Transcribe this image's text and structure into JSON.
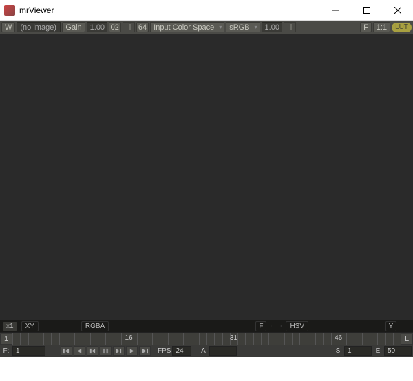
{
  "window": {
    "title": "mrViewer"
  },
  "toolbar": {
    "w": "W",
    "filename": "(no image)",
    "gain_label": "Gain",
    "gain_value": "1.00",
    "gamma_a": "02",
    "gamma_b": "64",
    "colorspace_label": "Input Color Space",
    "colorspace_value": "sRGB",
    "exposure": "1.00",
    "f_btn": "F",
    "ratio": "1:1",
    "lut": "LUT"
  },
  "status": {
    "zoom": "x1",
    "coord_mode": "XY",
    "channels": "RGBA",
    "f_indicator": "F",
    "color_mode": "HSV",
    "y_indicator": "Y"
  },
  "timeline": {
    "left_label": "1",
    "t1": "16",
    "t2": "31",
    "t3": "46",
    "right_label": "L"
  },
  "controls": {
    "f_label": "F:",
    "frame": "1",
    "fps_label": "FPS",
    "fps_value": "24",
    "a_label": "A",
    "s_label": "S",
    "s_value": "1",
    "e_label": "E",
    "e_value": "50"
  }
}
